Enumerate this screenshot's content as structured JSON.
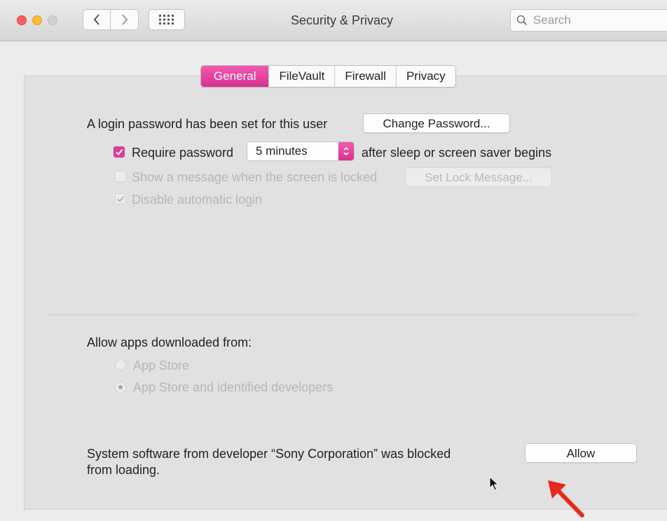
{
  "window": {
    "title": "Security & Privacy"
  },
  "search": {
    "placeholder": "Search"
  },
  "tabs": [
    {
      "label": "General",
      "active": true
    },
    {
      "label": "FileVault",
      "active": false
    },
    {
      "label": "Firewall",
      "active": false
    },
    {
      "label": "Privacy",
      "active": false
    }
  ],
  "general": {
    "login_password_text": "A login password has been set for this user",
    "change_password_label": "Change Password...",
    "require_password_label": "Require password",
    "require_password_checked": true,
    "require_password_delay": "5 minutes",
    "after_sleep_text": "after sleep or screen saver begins",
    "show_message_label": "Show a message when the screen is locked",
    "show_message_checked": false,
    "set_lock_message_label": "Set Lock Message...",
    "disable_auto_login_label": "Disable automatic login",
    "disable_auto_login_checked": true
  },
  "allow_apps": {
    "heading": "Allow apps downloaded from:",
    "options": [
      {
        "label": "App Store",
        "selected": false
      },
      {
        "label": "App Store and identified developers",
        "selected": true
      }
    ]
  },
  "blocked": {
    "line1": "System software from developer “Sony Corporation” was blocked",
    "line2": "from loading.",
    "allow_label": "Allow"
  },
  "colors": {
    "accent": "#dc3c97",
    "annotation_arrow": "#e8281e"
  }
}
